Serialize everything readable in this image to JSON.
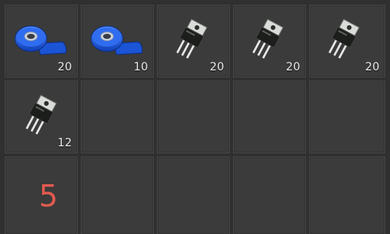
{
  "inventory": {
    "slots": [
      {
        "item": "blue-tape-icon",
        "quantity": "20"
      },
      {
        "item": "blue-tape-icon",
        "quantity": "10"
      },
      {
        "item": "transistor-icon",
        "quantity": "20"
      },
      {
        "item": "transistor-icon",
        "quantity": "20"
      },
      {
        "item": "transistor-icon",
        "quantity": "20"
      },
      {
        "item": "transistor-icon",
        "quantity": "12"
      }
    ],
    "hotkey_number": "5"
  },
  "colors": {
    "background": "#2f302f",
    "slot": "#3a3b3a",
    "tape_blue": "#1f63e0",
    "hotkey_red": "#e25a50"
  }
}
